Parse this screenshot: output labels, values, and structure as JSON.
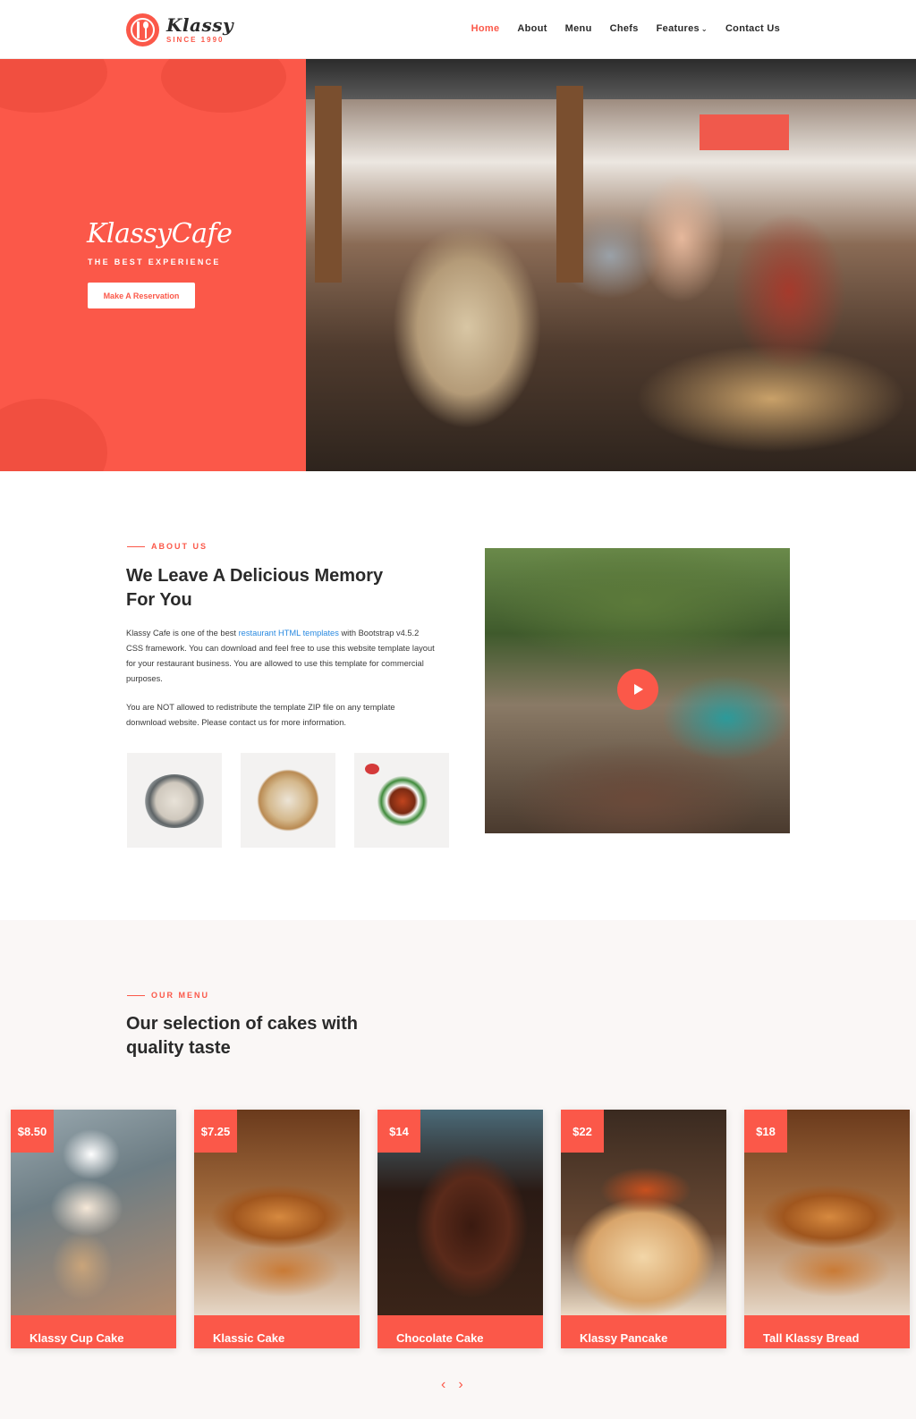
{
  "brand": {
    "name": "Klassy",
    "tagline": "SINCE 1990"
  },
  "nav": [
    {
      "label": "Home",
      "active": true
    },
    {
      "label": "About"
    },
    {
      "label": "Menu"
    },
    {
      "label": "Chefs"
    },
    {
      "label": "Features",
      "has_caret": true
    },
    {
      "label": "Contact Us"
    }
  ],
  "nav_caret": "⌄",
  "hero": {
    "title": "KlassyCafe",
    "subtitle": "THE BEST EXPERIENCE",
    "cta": "Make A Reservation"
  },
  "about": {
    "label": "ABOUT US",
    "title": "We Leave A Delicious Memory For You",
    "p1_before": "Klassy Cafe is one of the best ",
    "p1_link": "restaurant HTML templates",
    "p1_after": " with Bootstrap v4.5.2 CSS framework. You can download and feel free to use this website template layout for your restaurant business. You are allowed to use this template for commercial purposes.",
    "p2": "You are NOT allowed to redistribute the template ZIP file on any template donwnload website. Please contact us for more information."
  },
  "menu": {
    "label": "OUR MENU",
    "title": "Our selection of cakes with quality taste",
    "items": [
      {
        "price": "$8.50",
        "name": "Klassy Cup Cake"
      },
      {
        "price": "$7.25",
        "name": "Klassic Cake"
      },
      {
        "price": "$14",
        "name": "Chocolate Cake"
      },
      {
        "price": "$22",
        "name": "Klassy Pancake"
      },
      {
        "price": "$18",
        "name": "Tall Klassy Bread"
      }
    ],
    "prev": "‹",
    "next": "›"
  },
  "colors": {
    "accent": "#fb5849",
    "text": "#2a2a2a",
    "link": "#2a8ae0",
    "section_bg": "#faf7f6"
  }
}
